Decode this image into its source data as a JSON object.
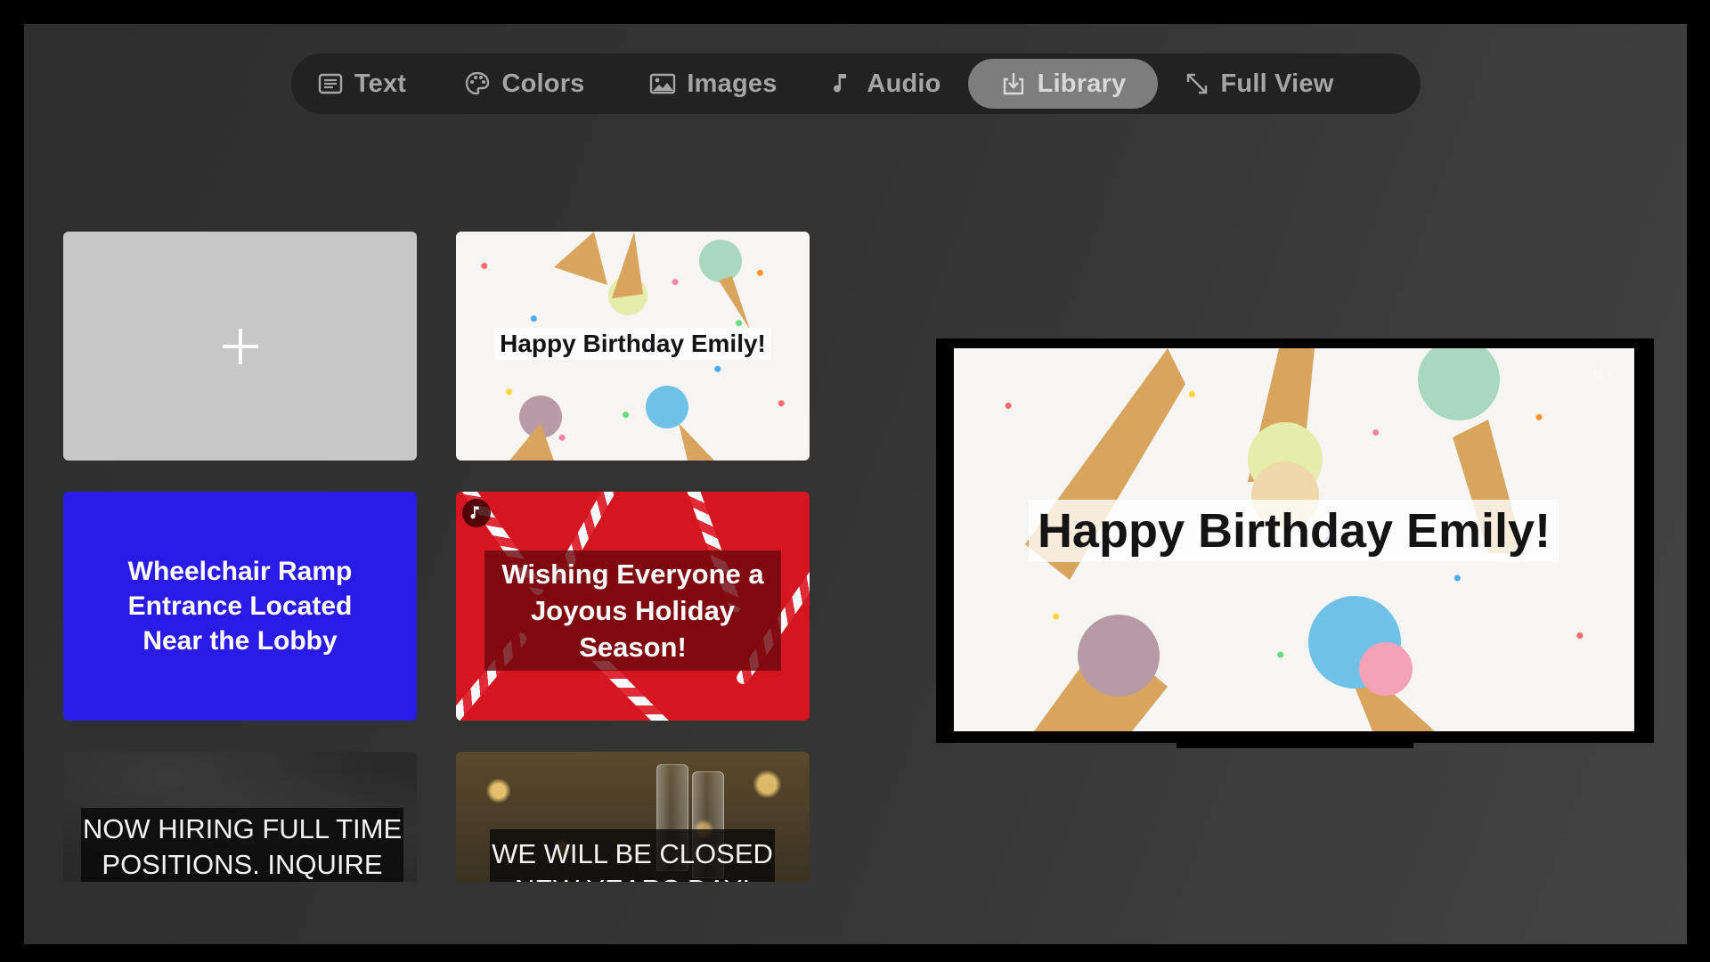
{
  "menu": {
    "tabs": [
      {
        "label": "Text",
        "icon": "text-icon",
        "active": false
      },
      {
        "label": "Colors",
        "icon": "palette-icon",
        "active": false
      },
      {
        "label": "Images",
        "icon": "image-icon",
        "active": false
      },
      {
        "label": "Audio",
        "icon": "music-note-icon",
        "active": false
      },
      {
        "label": "Library",
        "icon": "download-tray-icon",
        "active": true
      },
      {
        "label": "Full View",
        "icon": "expand-arrows-icon",
        "active": false
      }
    ]
  },
  "library": {
    "add_tile_icon": "plus-icon",
    "tiles": [
      {
        "text": "Happy Birthday Emily!",
        "background": "ice-cream-cones-confetti",
        "audio": false
      },
      {
        "text": "Wheelchair Ramp Entrance Located Near the Lobby",
        "background": "#2a1be8",
        "audio": false
      },
      {
        "text": "Wishing Everyone a Joyous Holiday Season!",
        "background": "candy-canes-red",
        "audio": true
      },
      {
        "text": "NOW HIRING FULL TIME POSITIONS. INQUIRE",
        "background": "chalkboard",
        "audio": false
      },
      {
        "text": "WE WILL BE CLOSED NEW YEARS DAY!",
        "background": "champagne-glasses-bokeh",
        "audio": false
      }
    ]
  },
  "preview": {
    "text": "Happy Birthday Emily!",
    "mute_icon": "speaker-muted-icon"
  },
  "colors": {
    "menu_bg": "#222222",
    "active_tab": "#7d7d7d",
    "tab_text": "#a5a5a5",
    "blue_tile": "#2a1be8",
    "red_tile": "#d41620"
  }
}
